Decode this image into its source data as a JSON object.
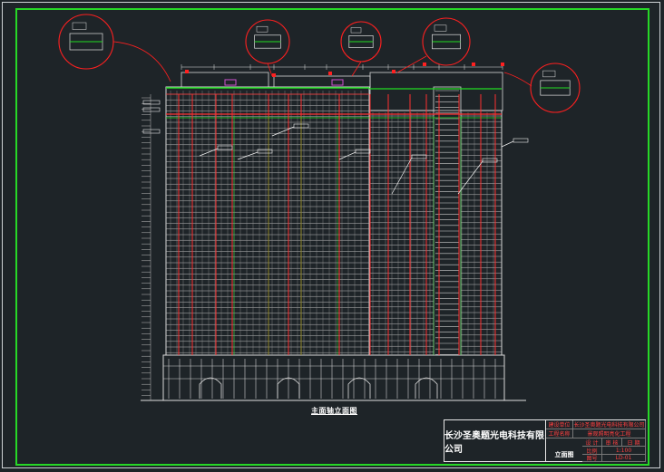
{
  "drawing": {
    "view_title": "主面轴立面图",
    "sheet_name": "立面图"
  },
  "title_block": {
    "company": "长沙圣奥题光电科技有限公司",
    "row_labels": [
      "建设单位",
      "工程名称"
    ],
    "row_values": [
      "长沙圣奥题光电科技有限公司",
      "景观照明亮化工程"
    ],
    "bottom_labels": [
      "设 计",
      "审 核",
      "日 期"
    ],
    "bottom_values": [
      "",
      "",
      ""
    ],
    "scale_label": "比例",
    "scale_value": "1:100",
    "sheet_no_label": "图号",
    "sheet_no_value": "LD-01"
  },
  "colors": {
    "background": "#1e2428",
    "frame": "#27d827",
    "facade_line": "#e6e6e6",
    "light_strip": "#ff3030",
    "annotation": "#22dd22",
    "leader": "#ff2020"
  }
}
